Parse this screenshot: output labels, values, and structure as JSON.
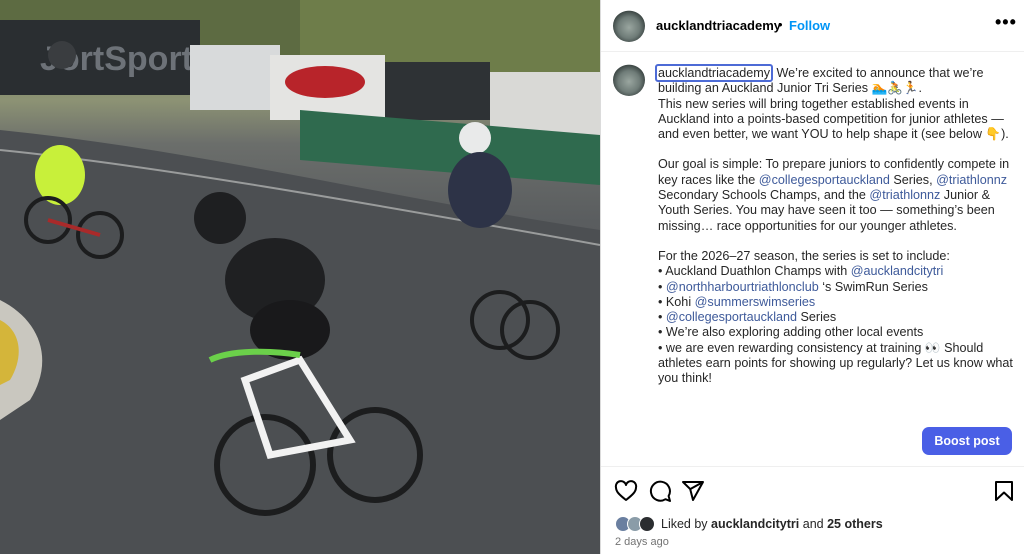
{
  "post": {
    "username": "aucklandtriacademy",
    "dot": "•",
    "follow_label": "Follow",
    "more_label": "•••"
  },
  "caption": {
    "username": "aucklandtriacademy",
    "line1": " We’re excited to announce that we’re building an Auckland Junior Tri Series 🏊🚴🏃.",
    "line2": "This new series will bring together established events in Auckland into a points-based competition for junior athletes — and even better, we want YOU to help shape it (see below 👇).",
    "goal_a": "Our goal is simple: To prepare juniors to confidently compete in key races like the ",
    "goal_m1": "@collegesportauckland",
    "goal_b": " Series, ",
    "goal_m2": "@triathlonnz",
    "goal_c": " Secondary Schools Champs, and the ",
    "goal_m3": "@triathlonnz",
    "goal_d": " Junior & Youth Series. You may have seen it too — something’s been missing… race opportunities for our younger athletes.",
    "season_intro": "For the 2026–27 season, the series is set to include:",
    "b1_text": "• Auckland Duathlon Champs with ",
    "b1_mention": "@aucklandcitytri",
    "b2_bullet": "• ",
    "b2_mention": "@northharbourtriathlonclub",
    "b2_text": " ‘s SwimRun Series",
    "b3_text": "• Kohi ",
    "b3_mention": "@summerswimseries",
    "b4_bullet": "• ",
    "b4_mention": "@collegesportauckland",
    "b4_text": " Series",
    "b5_text": "• We’re also exploring adding other local events",
    "b6_text": "• we are even rewarding consistency at training 👀 Should athletes earn points for showing up regularly? Let us know what you think!"
  },
  "boost_label": "Boost post",
  "likes": {
    "prefix": "Liked by ",
    "user": "aucklandcitytri",
    "and": " and ",
    "others": "25 others"
  },
  "timestamp": "2 days ago",
  "colors": {
    "accent": "#0095f6",
    "boost": "#4a5fe6",
    "mention": "#3e5a9a"
  },
  "icons": [
    "heart-icon",
    "comment-icon",
    "share-icon",
    "bookmark-icon"
  ]
}
